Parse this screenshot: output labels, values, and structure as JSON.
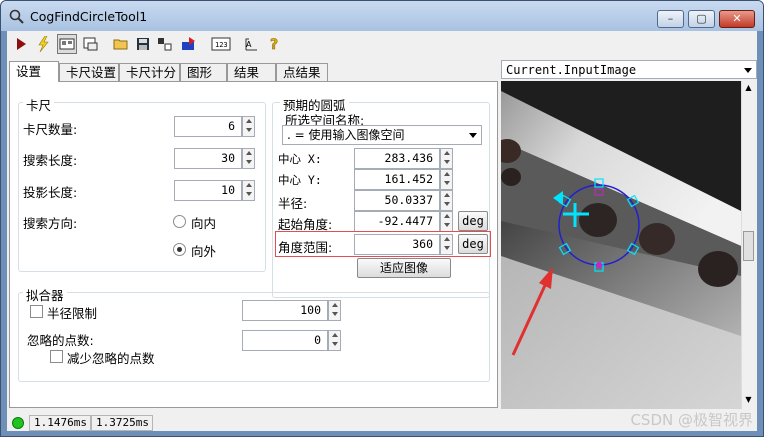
{
  "window": {
    "title": "CogFindCircleTool1"
  },
  "tabs": [
    "设置",
    "卡尺设置",
    "卡尺计分",
    "图形",
    "结果",
    "点结果"
  ],
  "caliper": {
    "group_label": "卡尺",
    "count_label": "卡尺数量:",
    "count_value": "6",
    "search_length_label": "搜索长度:",
    "search_length_value": "30",
    "projection_length_label": "投影长度:",
    "projection_length_value": "10",
    "search_direction_label": "搜索方向:",
    "inward_label": "向内",
    "outward_label": "向外",
    "selected": "向外"
  },
  "expected_arc": {
    "group_label": "预期的圆弧",
    "space_name_label": "所选空间名称:",
    "space_value": ". = 使用输入图像空间",
    "center_x_label": "中心 X:",
    "center_x_value": "283.436",
    "center_y_label": "中心 Y:",
    "center_y_value": "161.452",
    "radius_label": "半径:",
    "radius_value": "50.0337",
    "start_angle_label": "起始角度:",
    "start_angle_value": "-92.4477",
    "angle_span_label": "角度范围:",
    "angle_span_value": "360",
    "deg_label": "deg",
    "fit_button": "适应图像"
  },
  "fitter": {
    "group_label": "拟合器",
    "radius_limit_label": "半径限制",
    "radius_limit_value": "100",
    "ignored_points_label": "忽略的点数:",
    "ignored_points_value": "0",
    "reduce_ignored_label": "减少忽略的点数"
  },
  "image_view": {
    "selector_value": "Current.InputImage"
  },
  "status": {
    "time1": "1.1476ms",
    "time2": "1.3725ms",
    "indicator_color": "#1fc41f"
  },
  "watermark": "CSDN @极智视界",
  "colors": {
    "highlight": "#e05050",
    "overlay_cyan": "#00e5ff",
    "overlay_blue": "#2020d0",
    "overlay_magenta": "#d020d0",
    "arrow": "#e03030"
  }
}
